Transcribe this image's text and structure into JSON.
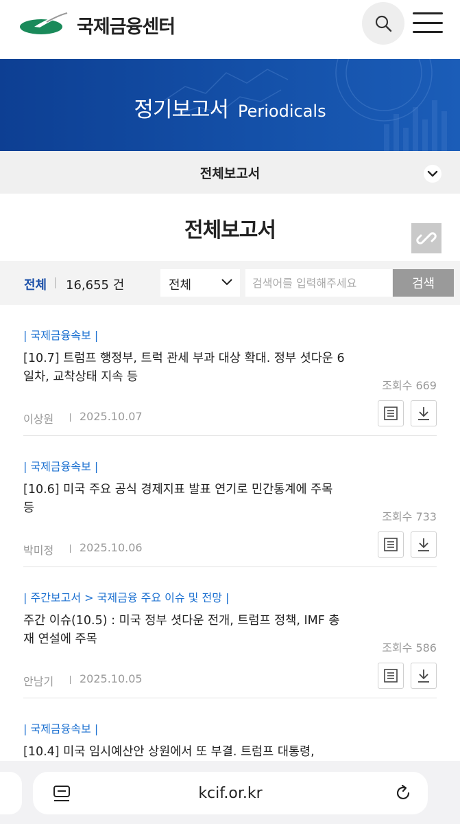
{
  "header": {
    "logo_text": "국제금융센터",
    "colors": {
      "logo_green": "#1a8a5a",
      "brand_blue": "#1a4fa8",
      "link_blue": "#1a6fd0"
    }
  },
  "banner": {
    "title_ko": "정기보고서",
    "title_en": "Periodicals"
  },
  "category_select": {
    "label": "전체보고서"
  },
  "section_title": "전체보고서",
  "filter": {
    "total_label": "전체",
    "total_count": "16,655 건",
    "field_select": "전체",
    "search_placeholder": "검색어를 입력해주세요",
    "search_button": "검색"
  },
  "reports": [
    {
      "category": "| 국제금융속보 |",
      "title": "[10.7] 트럼프 행정부, 트럭 관세 부과 대상 확대. 정부 셧다운 6일차, 교착상태 지속 등",
      "views": "조회수 669",
      "author": "이상원",
      "date": "2025.10.07"
    },
    {
      "category": "| 국제금융속보 |",
      "title": "[10.6] 미국 주요 공식 경제지표 발표 연기로 민간통계에 주목 등",
      "views": "조회수 733",
      "author": "박미정",
      "date": "2025.10.06"
    },
    {
      "category": "| 주간보고서 > 국제금융 주요 이슈 및 전망 |",
      "title": "주간 이슈(10.5) : 미국 정부 셧다운 전개, 트럼프 정책, IMF 총재 연설에 주목",
      "views": "조회수 586",
      "author": "안남기",
      "date": "2025.10.05"
    },
    {
      "category": "| 국제금융속보 |",
      "title": "[10.4] 미국 임시예산안 상원에서 또 부결. 트럼프 대통령,",
      "views": "",
      "author": "",
      "date": ""
    }
  ],
  "browser": {
    "url": "kcif.or.kr"
  }
}
